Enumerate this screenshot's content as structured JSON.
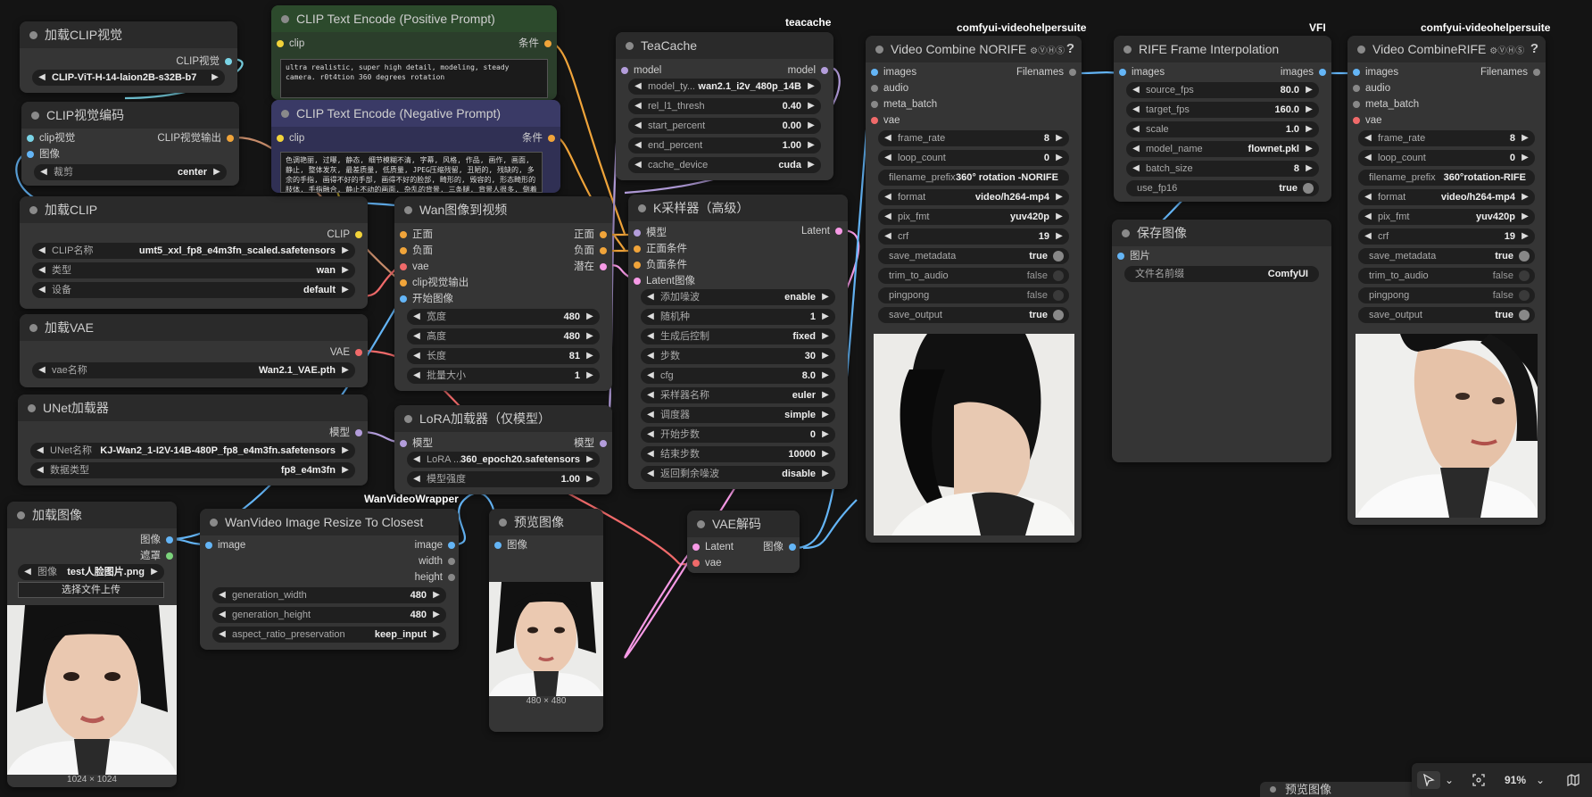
{
  "colors": {
    "clip_vision": "#7ad4e6",
    "conditioning": "#f0a43a",
    "clip": "#f2d33a",
    "image": "#64b5f6",
    "vae": "#f06a6a",
    "latent": "#f79ae6",
    "model": "#b39ddb",
    "mask": "#7bd37b"
  },
  "badges": {
    "teacache": "teacache",
    "vhs1": "comfyui-videohelpersuite",
    "vfi": "VFI",
    "vhs2": "comfyui-videohelpersuite",
    "wrapper": "WanVideoWrapper"
  },
  "nodes": {
    "clip_vision_loader": {
      "title": "加载CLIP视觉",
      "out": "CLIP视觉",
      "clip_name": "CLIP-ViT-H-14-laion2B-s32B-b7"
    },
    "clip_vision_encode": {
      "title": "CLIP视觉编码",
      "in1": "clip视觉",
      "in2": "图像",
      "out": "CLIP视觉输出",
      "crop_label": "裁剪",
      "crop_value": "center"
    },
    "load_clip": {
      "title": "加载CLIP",
      "out": "CLIP",
      "w1_label": "CLIP名称",
      "w1_value": "umt5_xxl_fp8_e4m3fn_scaled.safetensors",
      "w2_label": "类型",
      "w2_value": "wan",
      "w3_label": "设备",
      "w3_value": "default"
    },
    "load_vae": {
      "title": "加载VAE",
      "out": "VAE",
      "w_label": "vae名称",
      "w_value": "Wan2.1_VAE.pth"
    },
    "unet_loader": {
      "title": "UNet加载器",
      "out": "模型",
      "w1_label": "UNet名称",
      "w1_value": "KJ-Wan2_1-I2V-14B-480P_fp8_e4m3fn.safetensors",
      "w2_label": "数据类型",
      "w2_value": "fp8_e4m3fn"
    },
    "pos_prompt": {
      "title": "CLIP Text Encode (Positive Prompt)",
      "in": "clip",
      "out": "条件",
      "text": "ultra realistic, super high detail, modeling, steady camera. r0t4tion 360 degrees rotation"
    },
    "neg_prompt": {
      "title": "CLIP Text Encode (Negative Prompt)",
      "in": "clip",
      "out": "条件",
      "text": "色调艳丽, 过曝, 静态, 细节模糊不清, 字幕, 风格, 作品, 画作, 画面, 静止, 整体发灰, 最差质量, 低质量, JPEG压缩残留, 丑陋的, 残缺的, 多余的手指, 画得不好的手部, 画得不好的脸部, 畸形的, 毁容的, 形态畸形的肢体, 手指融合, 静止不动的画面, 杂乱的背景, 三条腿, 背景人很多, 倒着走"
    },
    "teacache": {
      "title": "TeaCache",
      "in": "model",
      "out": "model",
      "w1_label": "model_ty...",
      "w1_value": "wan2.1_i2v_480p_14B",
      "w2_label": "rel_l1_thresh",
      "w2_value": "0.40",
      "w3_label": "start_percent",
      "w3_value": "0.00",
      "w4_label": "end_percent",
      "w4_value": "1.00",
      "w5_label": "cache_device",
      "w5_value": "cuda"
    },
    "wan_i2v": {
      "title": "Wan图像到视频",
      "in1": "正面",
      "in2": "负面",
      "in3": "vae",
      "in4": "clip视觉输出",
      "in5": "开始图像",
      "out1": "正面",
      "out2": "负面",
      "out3": "潜在",
      "w1_label": "宽度",
      "w1_value": "480",
      "w2_label": "高度",
      "w2_value": "480",
      "w3_label": "长度",
      "w3_value": "81",
      "w4_label": "批量大小",
      "w4_value": "1"
    },
    "ksampler": {
      "title": "K采样器（高级）",
      "in1": "模型",
      "in2": "正面条件",
      "in3": "负面条件",
      "in4": "Latent图像",
      "out": "Latent",
      "w1_label": "添加噪波",
      "w1_value": "enable",
      "w2_label": "随机种",
      "w2_value": "1",
      "w3_label": "生成后控制",
      "w3_value": "fixed",
      "w4_label": "步数",
      "w4_value": "30",
      "w5_label": "cfg",
      "w5_value": "8.0",
      "w6_label": "采样器名称",
      "w6_value": "euler",
      "w7_label": "调度器",
      "w7_value": "simple",
      "w8_label": "开始步数",
      "w8_value": "0",
      "w9_label": "结束步数",
      "w9_value": "10000",
      "w10_label": "返回剩余噪波",
      "w10_value": "disable"
    },
    "lora": {
      "title": "LoRA加载器（仅模型）",
      "in": "模型",
      "out": "模型",
      "w1_label": "LoRA ...",
      "w1_value": "360_epoch20.safetensors",
      "w2_label": "模型强度",
      "w2_value": "1.00"
    },
    "video_combine_norife": {
      "title": "Video Combine NORIFE",
      "help": "?",
      "in1": "images",
      "in2": "audio",
      "in3": "meta_batch",
      "in4": "vae",
      "out": "Filenames",
      "w1_label": "frame_rate",
      "w1_value": "8",
      "w2_label": "loop_count",
      "w2_value": "0",
      "w3_label": "filename_prefix",
      "w3_value": "360° rotation -NORIFE",
      "w4_label": "format",
      "w4_value": "video/h264-mp4",
      "w5_label": "pix_fmt",
      "w5_value": "yuv420p",
      "w6_label": "crf",
      "w6_value": "19",
      "w7_label": "save_metadata",
      "w7_value": "true",
      "w8_label": "trim_to_audio",
      "w8_value": "false",
      "w9_label": "pingpong",
      "w9_value": "false",
      "w10_label": "save_output",
      "w10_value": "true"
    },
    "rife": {
      "title": "RIFE Frame Interpolation",
      "in": "images",
      "out": "images",
      "w1_label": "source_fps",
      "w1_value": "80.0",
      "w2_label": "target_fps",
      "w2_value": "160.0",
      "w3_label": "scale",
      "w3_value": "1.0",
      "w4_label": "model_name",
      "w4_value": "flownet.pkl",
      "w5_label": "batch_size",
      "w5_value": "8",
      "w6_label": "use_fp16",
      "w6_value": "true"
    },
    "save_image": {
      "title": "保存图像",
      "in": "图片",
      "w_label": "文件名前缀",
      "w_value": "ComfyUI"
    },
    "video_combine_rife": {
      "title": "Video CombineRIFE",
      "help": "?",
      "in1": "images",
      "in2": "audio",
      "in3": "meta_batch",
      "in4": "vae",
      "out": "Filenames",
      "w1_label": "frame_rate",
      "w1_value": "8",
      "w2_label": "loop_count",
      "w2_value": "0",
      "w3_label": "filename_prefix",
      "w3_value": "360°rotation-RIFE",
      "w4_label": "format",
      "w4_value": "video/h264-mp4",
      "w5_label": "pix_fmt",
      "w5_value": "yuv420p",
      "w6_label": "crf",
      "w6_value": "19",
      "w7_label": "save_metadata",
      "w7_value": "true",
      "w8_label": "trim_to_audio",
      "w8_value": "false",
      "w9_label": "pingpong",
      "w9_value": "false",
      "w10_label": "save_output",
      "w10_value": "true"
    },
    "load_image": {
      "title": "加载图像",
      "out1": "图像",
      "out2": "遮罩",
      "w_label": "图像",
      "w_value": "test人脸图片.png",
      "upload": "选择文件上传",
      "caption": "1024 × 1024"
    },
    "resize": {
      "title": "WanVideo Image Resize To Closest",
      "in": "image",
      "out1": "image",
      "out2": "width",
      "out3": "height",
      "w1_label": "generation_width",
      "w1_value": "480",
      "w2_label": "generation_height",
      "w2_value": "480",
      "w3_label": "aspect_ratio_preservation",
      "w3_value": "keep_input"
    },
    "preview": {
      "title": "预览图像",
      "in": "图像",
      "caption": "480 × 480"
    },
    "vae_decode": {
      "title": "VAE解码",
      "in1": "Latent",
      "in2": "vae",
      "out": "图像"
    },
    "preview_stub": {
      "title": "预览图像"
    }
  },
  "toolbar": {
    "zoom": "91%"
  }
}
